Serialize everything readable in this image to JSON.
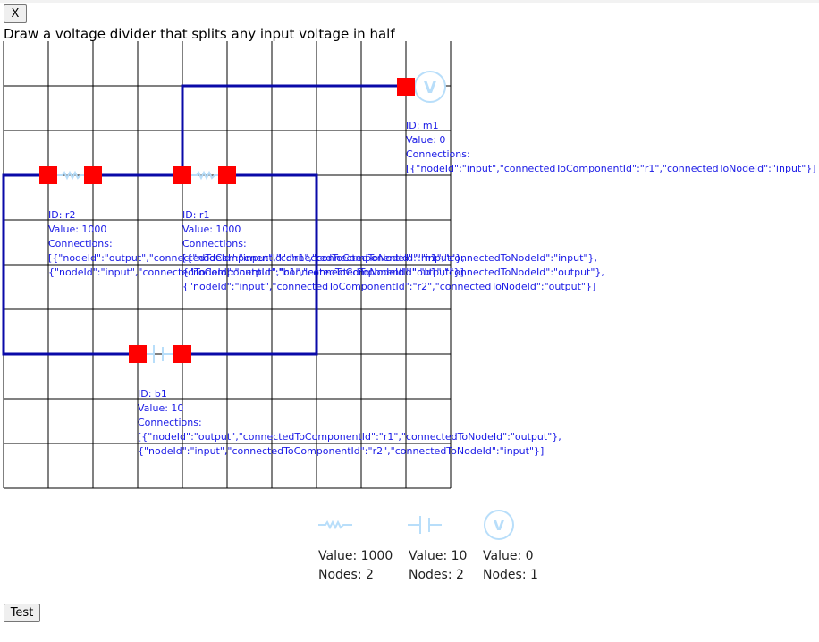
{
  "toolbar": {
    "close_label": "X"
  },
  "task": {
    "prompt": "Draw a voltage divider that splits any input voltage in half"
  },
  "components": [
    {
      "kind": "resistor",
      "id_label": "ID: r2",
      "value_label": "Value: 1000",
      "connections_label": "Connections:",
      "connections": [
        "[{\"nodeId\":\"output\",\"connectedToComponentId\":\"r1\",\"connectedToNodeId\":\"input\"},",
        "{\"nodeId\":\"input\",\"connectedToComponentId\":\"b1\",\"connectedToNodeId\":\"output\"}]"
      ]
    },
    {
      "kind": "resistor",
      "id_label": "ID: r1",
      "value_label": "Value: 1000",
      "connections_label": "Connections:",
      "connections": [
        "[{\"nodeId\":\"input\",\"connectedToComponentId\":\"m1\",\"connectedToNodeId\":\"input\"},",
        "{\"nodeId\":\"output\",\"connectedToComponentId\":\"b1\",\"connectedToNodeId\":\"output\"},",
        "{\"nodeId\":\"input\",\"connectedToComponentId\":\"r2\",\"connectedToNodeId\":\"output\"}]"
      ]
    },
    {
      "kind": "voltmeter",
      "id_label": "ID: m1",
      "value_label": "Value: 0",
      "connections_label": "Connections:",
      "connections": [
        "[{\"nodeId\":\"input\",\"connectedToComponentId\":\"r1\",\"connectedToNodeId\":\"input\"}]"
      ]
    },
    {
      "kind": "battery",
      "id_label": "ID: b1",
      "value_label": "Value: 10",
      "connections_label": "Connections:",
      "connections": [
        "[{\"nodeId\":\"output\",\"connectedToComponentId\":\"r1\",\"connectedToNodeId\":\"output\"},",
        "{\"nodeId\":\"input\",\"connectedToComponentId\":\"r2\",\"connectedToNodeId\":\"input\"}]"
      ]
    }
  ],
  "meter_symbol": "V",
  "palette": [
    {
      "kind": "resistor",
      "value_label": "Value: 1000",
      "nodes_label": "Nodes: 2"
    },
    {
      "kind": "battery",
      "value_label": "Value: 10",
      "nodes_label": "Nodes: 2"
    },
    {
      "kind": "voltmeter",
      "value_label": "Value: 0",
      "nodes_label": "Nodes: 1",
      "symbol": "V"
    }
  ],
  "actions": {
    "test_label": "Test"
  },
  "colors": {
    "wire": "#0a0aa8",
    "node": "#ff0000",
    "component": "#b8defa",
    "label_text": "#1a1ae6",
    "grid": "#000000"
  }
}
